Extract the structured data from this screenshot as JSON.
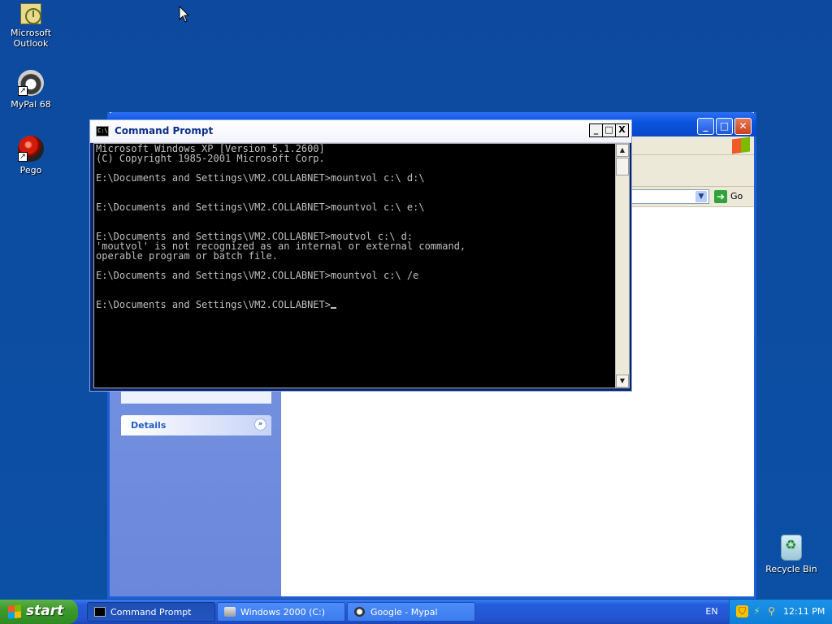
{
  "desktop": {
    "icons": [
      {
        "label": "Microsoft Outlook",
        "label_line1": "Microsoft",
        "label_line2": "Outlook"
      },
      {
        "label": "MyPal 68"
      },
      {
        "label": "Pego"
      },
      {
        "label": "Recycle Bin"
      }
    ]
  },
  "explorer": {
    "go_label": "Go",
    "details_label": "Details"
  },
  "cmd": {
    "title": "Command Prompt",
    "buttons": {
      "minimize": "_",
      "maximize": "□",
      "close": "X"
    },
    "lines": [
      "Microsoft Windows XP [Version 5.1.2600]",
      "(C) Copyright 1985-2001 Microsoft Corp.",
      "",
      "E:\\Documents and Settings\\VM2.COLLABNET>mountvol c:\\ d:\\",
      "",
      "",
      "E:\\Documents and Settings\\VM2.COLLABNET>mountvol c:\\ e:\\",
      "",
      "",
      "E:\\Documents and Settings\\VM2.COLLABNET>moutvol c:\\ d:",
      "'moutvol' is not recognized as an internal or external command,",
      "operable program or batch file.",
      "",
      "E:\\Documents and Settings\\VM2.COLLABNET>mountvol c:\\ /e",
      "",
      ""
    ],
    "prompt": "E:\\Documents and Settings\\VM2.COLLABNET>"
  },
  "taskbar": {
    "start_label": "start",
    "buttons": [
      {
        "label": "Command Prompt",
        "active": true
      },
      {
        "label": "Windows 2000 (C:)",
        "active": false
      },
      {
        "label": "Google - Mypal",
        "active": false
      }
    ],
    "language": "EN",
    "clock": "12:11 PM"
  },
  "colors": {
    "desktop": "#0b50a5",
    "console_text": "#c0c0c0",
    "taskbar": "#245edb",
    "start_button": "#3c9a2c"
  }
}
